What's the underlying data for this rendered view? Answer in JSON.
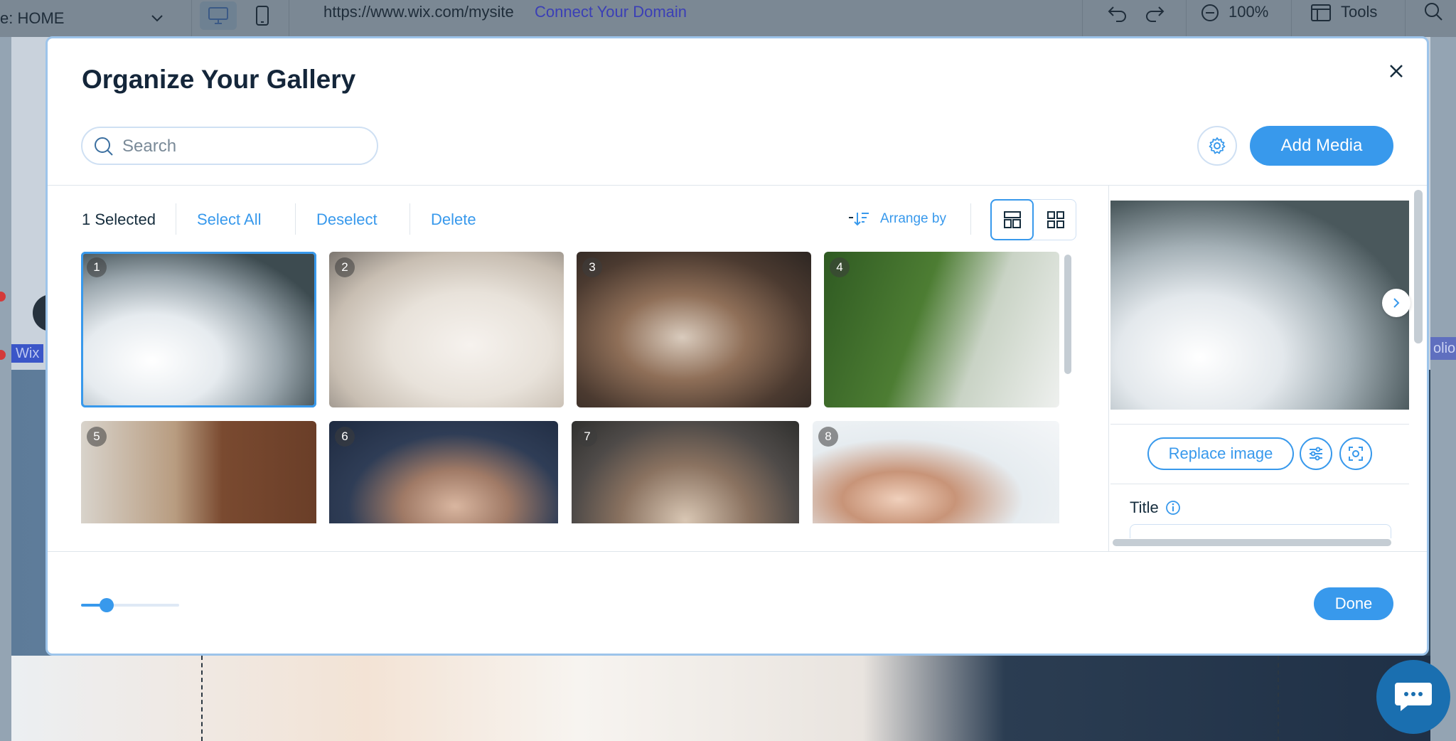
{
  "topbar": {
    "page_label": "e: HOME",
    "url": "https://www.wix.com/mysite",
    "connect_domain": "Connect Your Domain",
    "zoom": "100%",
    "tools": "Tools"
  },
  "background": {
    "wix_tag": "Wix",
    "folio_tag": "olio"
  },
  "modal": {
    "title": "Organize Your Gallery",
    "search_placeholder": "Search",
    "add_media": "Add Media",
    "selected_count": "1 Selected",
    "select_all": "Select All",
    "deselect": "Deselect",
    "delete": "Delete",
    "arrange_by": "Arrange by",
    "done": "Done",
    "thumbnail_size": 0.2
  },
  "gallery": {
    "items": [
      {
        "num": "1",
        "selected": true
      },
      {
        "num": "2",
        "selected": false
      },
      {
        "num": "3",
        "selected": false
      },
      {
        "num": "4",
        "selected": false
      },
      {
        "num": "5",
        "selected": false
      },
      {
        "num": "6",
        "selected": false
      },
      {
        "num": "7",
        "selected": false
      },
      {
        "num": "8",
        "selected": false
      }
    ]
  },
  "side_panel": {
    "replace_image": "Replace image",
    "title_label": "Title"
  },
  "colors": {
    "accent": "#3899ec",
    "text": "#162d3d",
    "border": "#cfe0f3"
  },
  "icons": [
    "chevron-down-icon",
    "desktop-icon",
    "mobile-icon",
    "undo-icon",
    "redo-icon",
    "zoom-out-icon",
    "tools-icon",
    "search-icon",
    "close-icon",
    "gear-icon",
    "arrange-icon",
    "layout-masonry-icon",
    "layout-grid-icon",
    "chevron-right-icon",
    "adjust-icon",
    "focal-point-icon",
    "info-icon",
    "chat-icon"
  ]
}
